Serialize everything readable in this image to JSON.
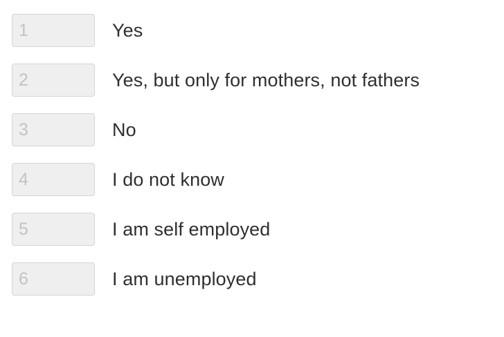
{
  "choices": [
    {
      "rank_placeholder": "1",
      "label": "Yes"
    },
    {
      "rank_placeholder": "2",
      "label": "Yes, but only for mothers, not fathers"
    },
    {
      "rank_placeholder": "3",
      "label": "No"
    },
    {
      "rank_placeholder": "4",
      "label": "I do not know"
    },
    {
      "rank_placeholder": "5",
      "label": "I am self employed"
    },
    {
      "rank_placeholder": "6",
      "label": "I am unemployed"
    }
  ]
}
